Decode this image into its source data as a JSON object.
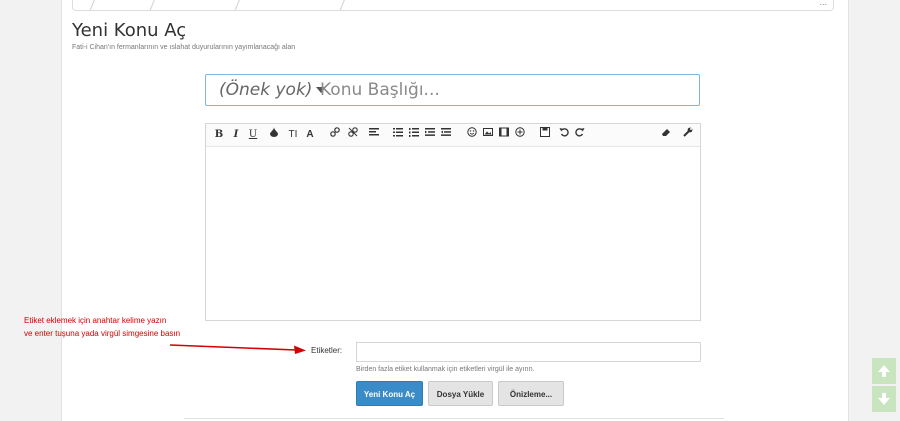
{
  "header": {
    "title": "Yeni Konu Aç",
    "subtitle": "Fati-i Cihan'ın fermanlarının ve ıslahat duyurularının yayımlanacağı alan",
    "menu_dots": "..."
  },
  "subject": {
    "prefix_label": "(Önek yok)",
    "placeholder": "Konu Başlığı..."
  },
  "toolbar": {
    "bold": "B",
    "italic": "I",
    "underline": "U",
    "text_size": "TI",
    "font": "A"
  },
  "tags": {
    "label": "Etiketler:",
    "hint": "Birden fazla etiket kullanmak için etiketleri virgül ile ayırın."
  },
  "buttons": {
    "create": "Yeni Konu Aç",
    "upload": "Dosya Yükle",
    "preview": "Önizleme..."
  },
  "annotation": {
    "line1": "Etiket eklemek için anahtar kelime yazın",
    "line2": "ve enter tuşuna yada virgül simgesine basın",
    "color": "#d40000"
  },
  "scroll": {
    "up_icon": "arrow-up-icon",
    "down_icon": "arrow-down-icon"
  },
  "colors": {
    "primary": "#3a8cc8",
    "subject_border": "#7fb6d9"
  }
}
